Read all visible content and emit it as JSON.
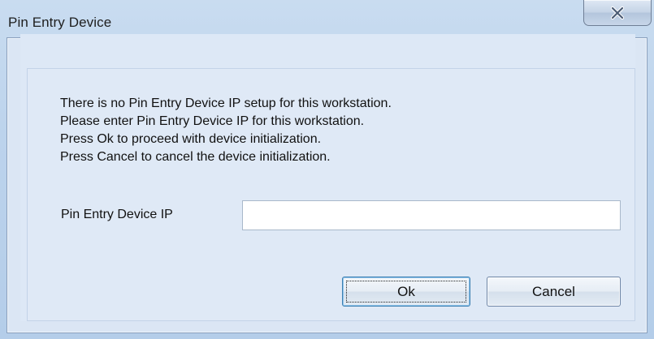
{
  "window": {
    "title": "Pin Entry Device",
    "close_icon": "close-icon"
  },
  "message": {
    "lines": [
      "There is no Pin Entry Device IP setup for this workstation.",
      "Please enter Pin Entry Device IP for this workstation.",
      "Press Ok to proceed with device initialization.",
      "Press Cancel to cancel the device initialization."
    ]
  },
  "form": {
    "ip_label": "Pin Entry Device IP",
    "ip_value": "",
    "ip_placeholder": ""
  },
  "buttons": {
    "ok_label": "Ok",
    "cancel_label": "Cancel"
  },
  "colors": {
    "frame_gradient_top": "#c9dcf0",
    "client_background": "#dde8f6",
    "default_button_border": "#3c7fb1"
  }
}
